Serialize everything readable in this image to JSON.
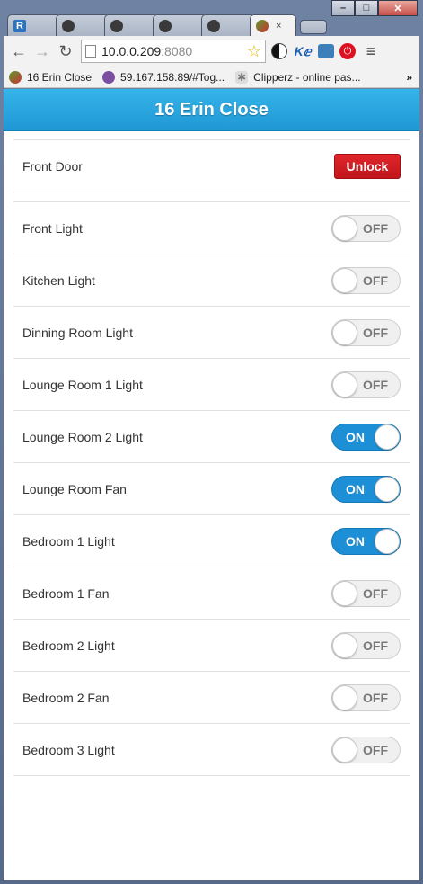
{
  "browser": {
    "tabs": [
      {
        "icon": "rb-favicon-icon",
        "letter": "R",
        "active": false
      },
      {
        "icon": "github-icon",
        "active": false
      },
      {
        "icon": "github-icon",
        "active": false
      },
      {
        "icon": "github-icon",
        "active": false
      },
      {
        "icon": "github-icon",
        "active": false
      },
      {
        "icon": "cherry-icon",
        "active": true,
        "close": "×"
      }
    ],
    "url_host": "10.0.0.209",
    "url_port": ":8080",
    "bookmarks": [
      {
        "label": "16 Erin Close"
      },
      {
        "label": "59.167.158.89/#Tog..."
      },
      {
        "label": "Clipperz - online pas..."
      }
    ],
    "bookmarks_more": "»"
  },
  "app": {
    "title": "16 Erin Close",
    "door": {
      "label": "Front Door",
      "button": "Unlock"
    },
    "switches": [
      {
        "label": "Front Light",
        "state": "OFF"
      },
      {
        "label": "Kitchen Light",
        "state": "OFF"
      },
      {
        "label": "Dinning Room Light",
        "state": "OFF"
      },
      {
        "label": "Lounge Room 1 Light",
        "state": "OFF"
      },
      {
        "label": "Lounge Room 2 Light",
        "state": "ON"
      },
      {
        "label": "Lounge Room Fan",
        "state": "ON"
      },
      {
        "label": "Bedroom 1 Light",
        "state": "ON"
      },
      {
        "label": "Bedroom 1 Fan",
        "state": "OFF"
      },
      {
        "label": "Bedroom 2 Light",
        "state": "OFF"
      },
      {
        "label": "Bedroom 2 Fan",
        "state": "OFF"
      },
      {
        "label": "Bedroom 3 Light",
        "state": "OFF"
      }
    ]
  },
  "colors": {
    "header": "#2aa6e0",
    "toggle_on": "#1d8fd6",
    "unlock": "#d01c20"
  }
}
